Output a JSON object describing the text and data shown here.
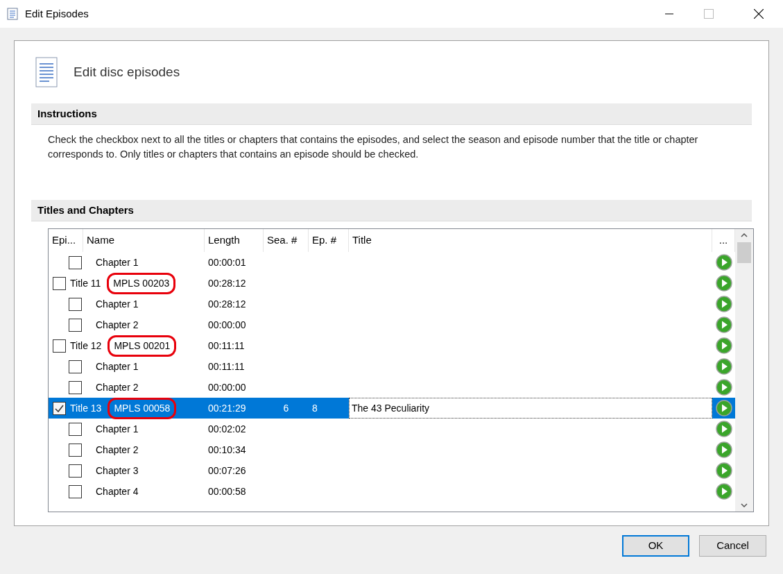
{
  "window": {
    "title": "Edit Episodes"
  },
  "header": {
    "title": "Edit disc episodes"
  },
  "instructions": {
    "heading": "Instructions",
    "text": "Check the checkbox next to all the titles or chapters that contains the episodes, and select the season and episode number that the title or chapter corresponds to. Only titles or chapters that contains an episode should be checked."
  },
  "titles_section": {
    "heading": "Titles and Chapters"
  },
  "table": {
    "columns": [
      "Epi...",
      "Name",
      "Length",
      "Sea. #",
      "Ep. #",
      "Title",
      "..."
    ],
    "rows": [
      {
        "kind": "chapter",
        "checked": false,
        "selected": false,
        "name": "Chapter 1",
        "length": "00:00:01"
      },
      {
        "kind": "title",
        "checked": false,
        "selected": false,
        "name": "Title 11",
        "playlist": "MPLS 00203",
        "annotated": true,
        "length": "00:28:12"
      },
      {
        "kind": "chapter",
        "checked": false,
        "selected": false,
        "name": "Chapter 1",
        "length": "00:28:12"
      },
      {
        "kind": "chapter",
        "checked": false,
        "selected": false,
        "name": "Chapter 2",
        "length": "00:00:00"
      },
      {
        "kind": "title",
        "checked": false,
        "selected": false,
        "name": "Title 12",
        "playlist": "MPLS 00201",
        "annotated": true,
        "length": "00:11:11"
      },
      {
        "kind": "chapter",
        "checked": false,
        "selected": false,
        "name": "Chapter 1",
        "length": "00:11:11"
      },
      {
        "kind": "chapter",
        "checked": false,
        "selected": false,
        "name": "Chapter 2",
        "length": "00:00:00"
      },
      {
        "kind": "title",
        "checked": true,
        "selected": true,
        "name": "Title 13",
        "playlist": "MPLS 00058",
        "annotated": true,
        "length": "00:21:29",
        "season": "6",
        "episode": "8",
        "title": "The 43 Peculiarity"
      },
      {
        "kind": "chapter",
        "checked": false,
        "selected": false,
        "name": "Chapter 1",
        "length": "00:02:02"
      },
      {
        "kind": "chapter",
        "checked": false,
        "selected": false,
        "name": "Chapter 2",
        "length": "00:10:34"
      },
      {
        "kind": "chapter",
        "checked": false,
        "selected": false,
        "name": "Chapter 3",
        "length": "00:07:26"
      },
      {
        "kind": "chapter",
        "checked": false,
        "selected": false,
        "name": "Chapter 4",
        "length": "00:00:58"
      }
    ]
  },
  "buttons": [
    {
      "label": "OK",
      "default": true
    },
    {
      "label": "Cancel",
      "default": false
    }
  ]
}
